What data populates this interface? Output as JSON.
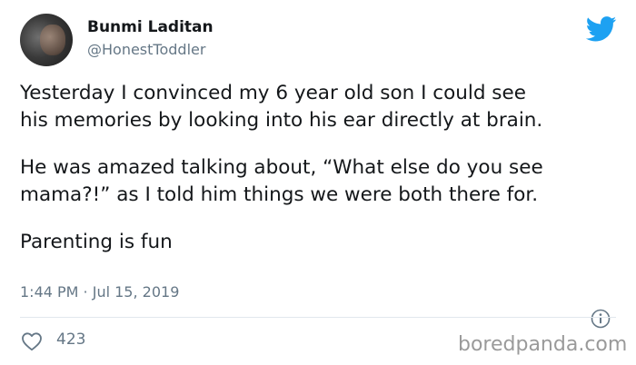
{
  "author": {
    "name": "Bunmi Laditan",
    "handle": "@HonestToddler"
  },
  "tweet": {
    "paragraphs": [
      "Yesterday I convinced my 6 year old son I could see\nhis memories by looking into his ear directly at brain.",
      "He was amazed talking about, “What else do you see\nmama?!” as I told him things we were both there for.",
      "Parenting is fun"
    ],
    "timestamp": "1:44 PM · Jul 15, 2019"
  },
  "engagement": {
    "likes": "423"
  },
  "watermark": "boredpanda.com",
  "icons": {
    "logo": "twitter-bird-icon",
    "info": "info-icon",
    "like": "heart-icon"
  },
  "colors": {
    "twitter_blue": "#1da1f2",
    "secondary_text": "#657786",
    "primary_text": "#14171a"
  }
}
